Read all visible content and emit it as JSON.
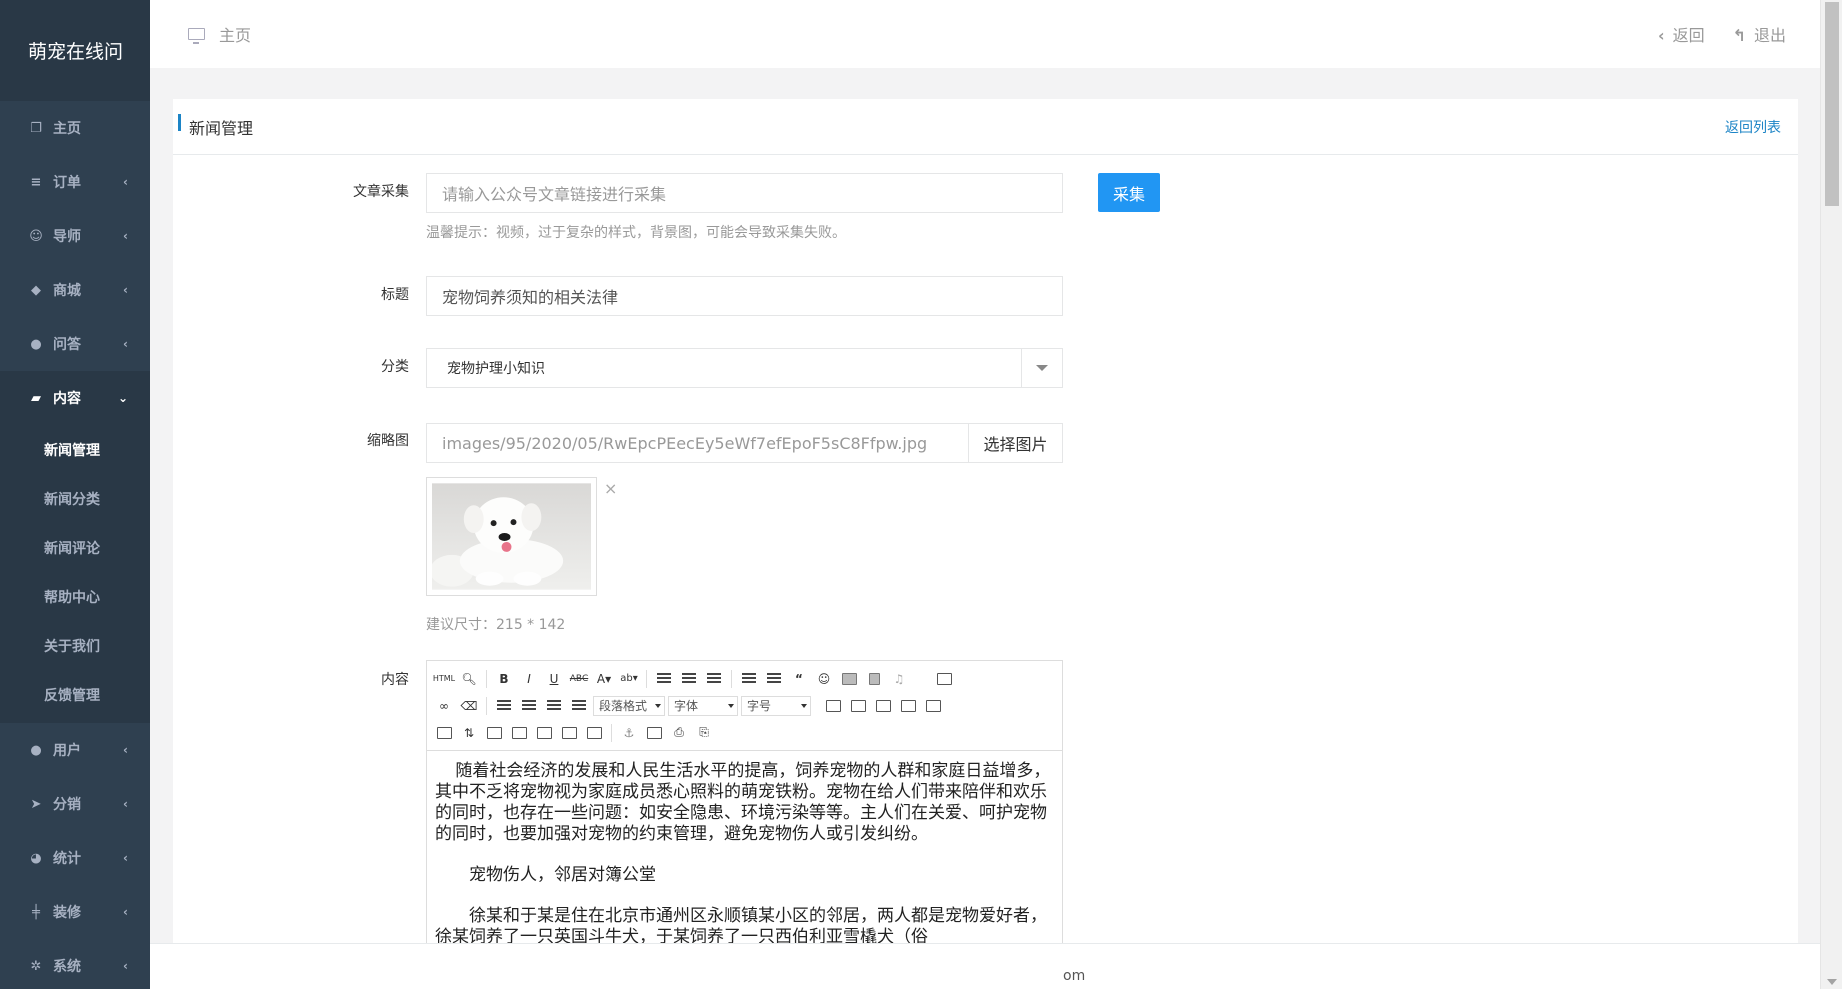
{
  "app": {
    "brand": "萌宠在线问"
  },
  "sidebar": {
    "items": [
      {
        "label": "主页",
        "icon": "copy-icon"
      },
      {
        "label": "订单",
        "icon": "menu-icon"
      },
      {
        "label": "导师",
        "icon": "user-icon"
      },
      {
        "label": "商城",
        "icon": "tags-icon"
      },
      {
        "label": "问答",
        "icon": "comment-icon"
      },
      {
        "label": "内容",
        "icon": "book-icon"
      }
    ],
    "content_sub": [
      {
        "label": "新闻管理"
      },
      {
        "label": "新闻分类"
      },
      {
        "label": "新闻评论"
      },
      {
        "label": "帮助中心"
      },
      {
        "label": "关于我们"
      },
      {
        "label": "反馈管理"
      }
    ],
    "items_after": [
      {
        "label": "用户",
        "icon": "user-icon"
      },
      {
        "label": "分销",
        "icon": "send-icon"
      },
      {
        "label": "统计",
        "icon": "pie-chart-icon"
      },
      {
        "label": "装修",
        "icon": "sliders-icon"
      },
      {
        "label": "系统",
        "icon": "gear-icon"
      }
    ]
  },
  "topbar": {
    "breadcrumb": "主页",
    "back_label": "返回",
    "logout_label": "退出"
  },
  "panel": {
    "title": "新闻管理",
    "back_to_list": "返回列表"
  },
  "form": {
    "collect": {
      "label": "文章采集",
      "placeholder": "请输入公众号文章链接进行采集",
      "button": "采集",
      "hint": "温馨提示：视频，过于复杂的样式，背景图，可能会导致采集失败。"
    },
    "title": {
      "label": "标题",
      "value": "宠物饲养须知的相关法律"
    },
    "category": {
      "label": "分类",
      "value": "宠物护理小知识"
    },
    "thumbnail": {
      "label": "缩略图",
      "value": "images/95/2020/05/RwEpcPEecEy5eWf7efEpoF5sC8Ffpw.jpg",
      "button": "选择图片",
      "hint": "建议尺寸：215 * 142"
    },
    "content": {
      "label": "内容",
      "toolbar": {
        "html": "HTML",
        "paragraph_format": "段落格式",
        "font_family": "字体",
        "font_size": "字号"
      },
      "paragraphs": [
        "随着社会经济的发展和人民生活水平的提高，饲养宠物的人群和家庭日益增多，其中不乏将宠物视为家庭成员悉心照料的萌宠铁粉。宠物在给人们带来陪伴和欢乐的同时，也存在一些问题：如安全隐患、环境污染等等。主人们在关爱、呵护宠物的同时，也要加强对宠物的约束管理，避免宠物伤人或引发纠纷。",
        "宠物伤人，邻居对簿公堂",
        "徐某和于某是住在北京市通州区永顺镇某小区的邻居，两人都是宠物爱好者，徐某饲养了一只英国斗牛犬，于某饲养了一只西伯利亚雪橇犬（俗"
      ]
    }
  },
  "footer": {
    "text": "om"
  }
}
